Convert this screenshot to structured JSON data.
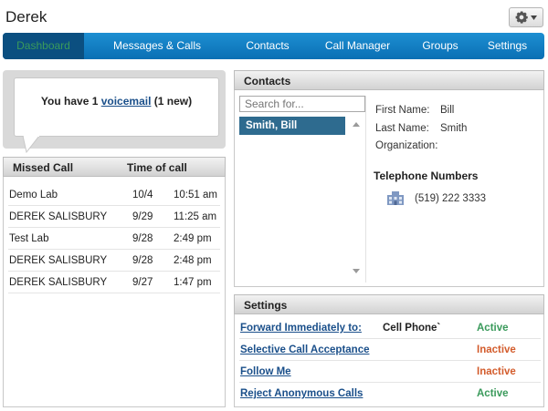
{
  "user": {
    "name": "Derek"
  },
  "gear": {
    "icon": "gear-icon",
    "caret": "chevron-down-icon"
  },
  "nav": {
    "tabs": [
      {
        "label": "Dashboard",
        "active": true
      },
      {
        "label": "Messages & Calls"
      },
      {
        "label": "Contacts"
      },
      {
        "label": "Call Manager"
      },
      {
        "label": "Groups"
      },
      {
        "label": "Settings"
      }
    ]
  },
  "voicemail": {
    "prefix": "You have 1 ",
    "link": "voicemail",
    "suffix": " (1 new)"
  },
  "missed_calls": {
    "header_name": "Missed Call",
    "header_time": "Time of call",
    "rows": [
      {
        "name": "Demo Lab",
        "date": "10/4",
        "time": "10:51 am"
      },
      {
        "name": "DEREK SALISBURY",
        "date": "9/29",
        "time": "11:25 am"
      },
      {
        "name": "Test Lab",
        "date": "9/28",
        "time": "2:49 pm"
      },
      {
        "name": "DEREK SALISBURY",
        "date": "9/28",
        "time": "2:48 pm"
      },
      {
        "name": "DEREK SALISBURY",
        "date": "9/27",
        "time": "1:47 pm"
      }
    ]
  },
  "contacts": {
    "title": "Contacts",
    "search_placeholder": "Search for...",
    "selected": "Smith, Bill",
    "first_name_label": "First Name:",
    "first_name": "Bill",
    "last_name_label": "Last Name:",
    "last_name": "Smith",
    "organization_label": "Organization:",
    "organization": "",
    "tel_title": "Telephone Numbers",
    "tel_number": "(519) 222 3333"
  },
  "settings": {
    "title": "Settings",
    "rows": [
      {
        "label": "Forward Immediately to:",
        "extra": "Cell Phone`",
        "status": "Active"
      },
      {
        "label": "Selective Call Acceptance",
        "extra": "",
        "status": "Inactive"
      },
      {
        "label": "Follow Me",
        "extra": "",
        "status": "Inactive"
      },
      {
        "label": "Reject Anonymous Calls",
        "extra": "",
        "status": "Active"
      }
    ]
  },
  "colors": {
    "nav": "#0a6fb4",
    "nav_active": "#0b4f80",
    "active": "#3a9a5b",
    "inactive": "#d35c2c",
    "link": "#1a4f8a"
  }
}
